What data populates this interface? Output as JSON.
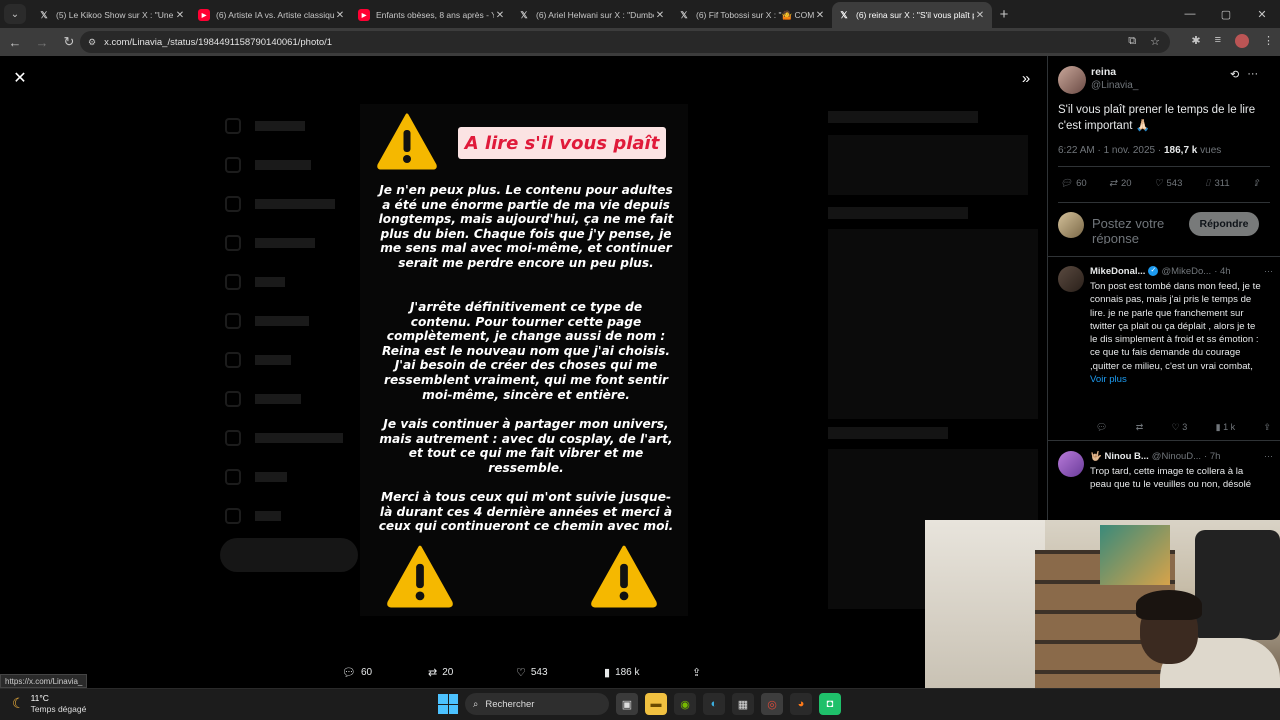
{
  "browser": {
    "tabs": [
      {
        "icon": "x-icon",
        "title": "(5) Le Kikoo Show sur X : \"Une",
        "active": false
      },
      {
        "icon": "youtube-icon",
        "title": "(6) Artiste IA vs. Artiste classiqu",
        "active": false
      },
      {
        "icon": "youtube-icon",
        "title": "Enfants obèses, 8 ans après - Yo",
        "active": false
      },
      {
        "icon": "x-icon",
        "title": "(6) Ariel Helwani sur X : \"Dumbe",
        "active": false
      },
      {
        "icon": "x-icon",
        "title": "(6) Fif Tobossi sur X : \"🤷 COMM",
        "active": false
      },
      {
        "icon": "x-icon",
        "title": "(6) reina sur X : \"S'il vous plaît p",
        "active": true
      }
    ],
    "url": "x.com/Linavia_/status/1984491158790140061/photo/1",
    "status_url": "https://x.com/Linavia_"
  },
  "photo": {
    "title": "A lire s'il vous plaît",
    "paragraphs": [
      "Je n'en peux plus. Le contenu pour adultes a été une énorme partie de ma vie depuis longtemps, mais aujourd'hui, ça ne me fait plus du bien. Chaque fois que j'y pense, je me sens mal avec moi-même, et continuer serait me perdre encore un peu plus.",
      "J'arrête définitivement ce type de contenu. Pour tourner cette page complètement, je change aussi de nom : Reina est le nouveau nom que j'ai choisis. J'ai besoin de créer des choses qui me ressemblent vraiment, qui me font sentir moi-même, sincère et entière.",
      "Je vais continuer à partager mon univers, mais autrement : avec du cosplay, de l'art, et tout ce qui me fait vibrer et me ressemble.",
      "Merci à tous ceux qui m'ont suivie jusque-là durant ces 4 dernière années et merci à ceux qui continueront ce chemin avec moi."
    ]
  },
  "photo_actions": {
    "replies": "60",
    "reposts": "20",
    "likes": "543",
    "views": "186 k"
  },
  "tweet": {
    "name": "reina",
    "handle": "@Linavia_",
    "text": "S'il vous plaît prener le temps de le lire c'est important 🙏🏻",
    "time": "6:22 AM · 1 nov. 2025 · ",
    "views_count": "186,7 k",
    "views_label": " vues",
    "stats": {
      "replies": "60",
      "reposts": "20",
      "likes": "543",
      "bookmarks": "311"
    }
  },
  "reply_box": {
    "placeholder": "Postez votre réponse",
    "button": "Répondre"
  },
  "comments": [
    {
      "name": "MikeDonal...",
      "handle": "@MikeDo...",
      "time": "· 4h",
      "text": "Ton post est tombé dans mon feed, je te connais pas, mais j'ai pris le temps de lire. je ne parle que franchement sur twitter ça plait ou ça déplait , alors je te le dis simplement à froid et ss émotion : ce que tu fais demande du courage ,quitter ce milieu, c'est un vrai combat,",
      "more": "Voir plus",
      "likes": "3",
      "views": "1 k"
    },
    {
      "name": "🤟🏼 Ninou B...",
      "handle": "@NinouD...",
      "time": "· 7h",
      "text": "Trop tard, cette image te collera à la peau que tu le veuilles ou non, désolé"
    }
  ],
  "taskbar": {
    "temp": "11°C",
    "weather": "Temps dégagé",
    "search": "Rechercher"
  },
  "colors": {
    "accent": "#1d9bf0",
    "title_red": "#e01a3a",
    "warning_yellow": "#f5b800"
  }
}
